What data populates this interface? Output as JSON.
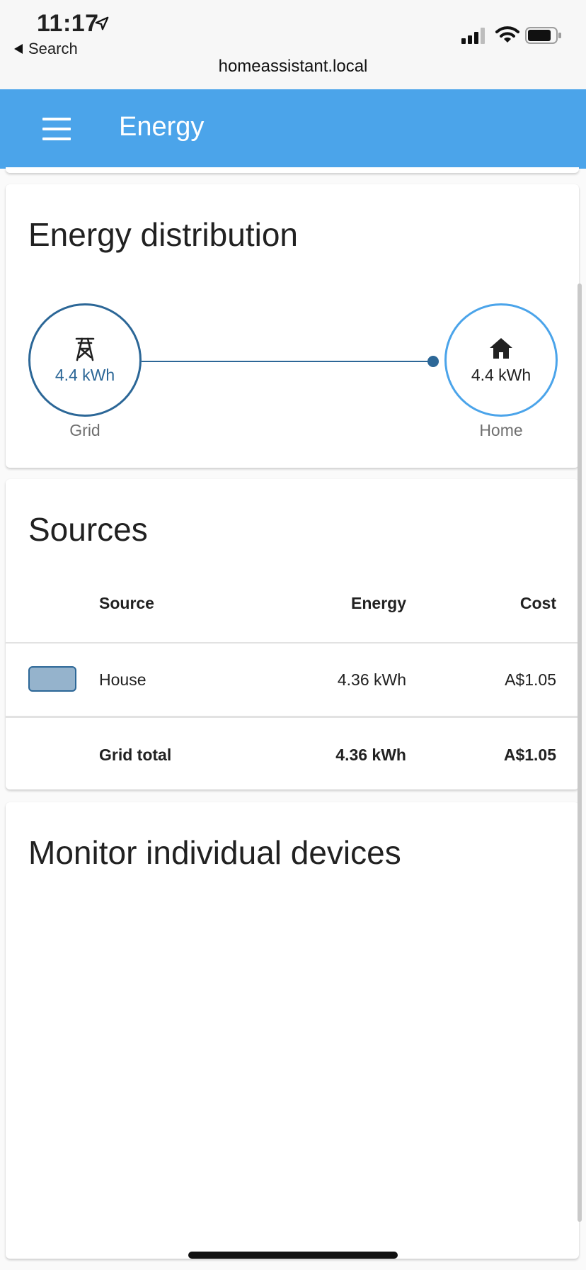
{
  "status_bar": {
    "time": "11:17",
    "back_label": "Search",
    "url": "homeassistant.local",
    "icons": [
      "location-arrow-icon",
      "cellular-signal-icon",
      "wifi-icon",
      "battery-icon"
    ]
  },
  "header": {
    "title": "Energy",
    "menu_icon": "hamburger-menu-icon",
    "background_color": "#4ba4ea"
  },
  "distribution": {
    "title": "Energy distribution",
    "grid": {
      "value": "4.4 kWh",
      "label": "Grid",
      "icon": "transmission-tower-icon",
      "color": "#2c6797"
    },
    "home": {
      "value": "4.4 kWh",
      "label": "Home",
      "icon": "home-icon",
      "color": "#4ba4ea"
    }
  },
  "sources": {
    "title": "Sources",
    "columns": [
      "Source",
      "Energy",
      "Cost"
    ],
    "rows": [
      {
        "name": "House",
        "energy": "4.36 kWh",
        "cost": "A$1.05",
        "swatch_color": "#95b3cc"
      }
    ],
    "total": {
      "name": "Grid total",
      "energy": "4.36 kWh",
      "cost": "A$1.05"
    }
  },
  "devices": {
    "title": "Monitor individual devices"
  }
}
